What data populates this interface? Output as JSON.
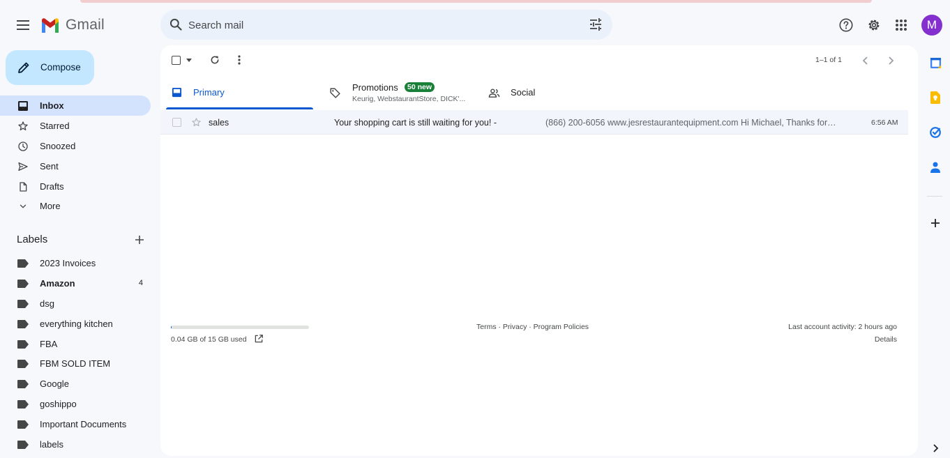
{
  "app": {
    "name": "Gmail"
  },
  "search": {
    "placeholder": "Search mail"
  },
  "header": {
    "avatar_letter": "M"
  },
  "sidebar": {
    "compose_label": "Compose",
    "items": [
      {
        "label": "Inbox",
        "icon": "inbox-icon",
        "active": true
      },
      {
        "label": "Starred",
        "icon": "star-icon"
      },
      {
        "label": "Snoozed",
        "icon": "clock-icon"
      },
      {
        "label": "Sent",
        "icon": "send-icon"
      },
      {
        "label": "Drafts",
        "icon": "draft-icon"
      },
      {
        "label": "More",
        "icon": "chevron-down-icon"
      }
    ],
    "labels_title": "Labels",
    "labels": [
      {
        "name": "2023 Invoices",
        "count": ""
      },
      {
        "name": "Amazon",
        "count": "4"
      },
      {
        "name": "dsg",
        "count": ""
      },
      {
        "name": "everything kitchen",
        "count": ""
      },
      {
        "name": "FBA",
        "count": ""
      },
      {
        "name": "FBM SOLD ITEM",
        "count": ""
      },
      {
        "name": "Google",
        "count": ""
      },
      {
        "name": "goshippo",
        "count": ""
      },
      {
        "name": "Important Documents",
        "count": ""
      },
      {
        "name": "labels",
        "count": ""
      }
    ]
  },
  "toolbar": {
    "pager": "1–1 of 1"
  },
  "tabs": {
    "primary": "Primary",
    "promotions": "Promotions",
    "promotions_badge": "50 new",
    "promotions_senders": "Keurig, WebstaurantStore, DICK'...",
    "social": "Social"
  },
  "emails": [
    {
      "sender": "sales",
      "subject": "Your shopping cart is still waiting for you! -",
      "snippet": "(866) 200-6056 www.jesrestaurantequipment.com Hi Michael, Thanks for shopping with us",
      "time": "6:56 AM"
    }
  ],
  "footer": {
    "storage_used": "0.04 GB of 15 GB used",
    "storage_fraction": 0.003,
    "links": "Terms · Privacy · Program Policies",
    "last_activity": "Last account activity: 2 hours ago",
    "details": "Details"
  },
  "colors": {
    "accent": "#0b57d0",
    "compose_bg": "#c2e7ff",
    "badge": "#188038",
    "avatar": "#8430ce"
  }
}
